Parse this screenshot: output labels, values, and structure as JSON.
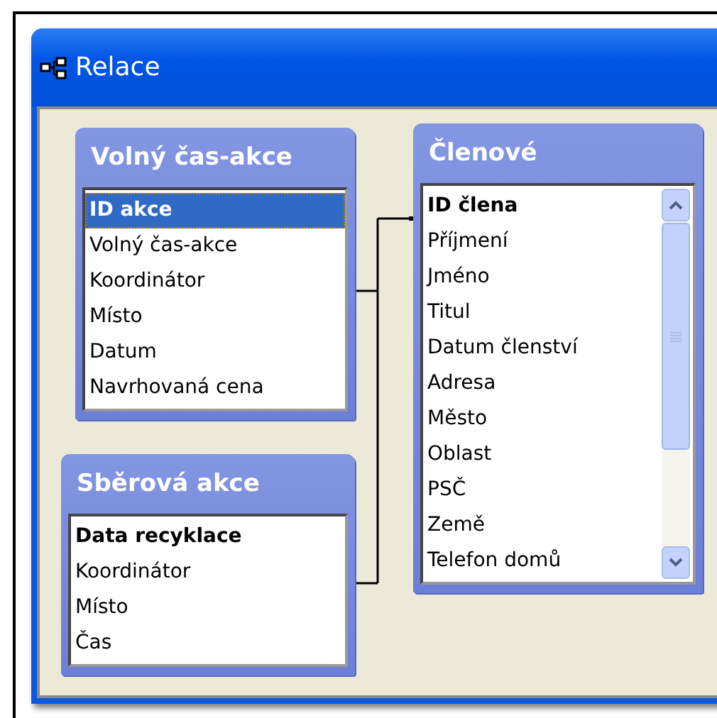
{
  "window": {
    "title": "Relace"
  },
  "tables": [
    {
      "title": "Volný čas-akce",
      "fields": [
        {
          "name": "ID akce",
          "key": true,
          "selected": true
        },
        {
          "name": "Volný čas-akce",
          "key": false,
          "selected": false
        },
        {
          "name": "Koordinátor",
          "key": false,
          "selected": false
        },
        {
          "name": "Místo",
          "key": false,
          "selected": false
        },
        {
          "name": "Datum",
          "key": false,
          "selected": false
        },
        {
          "name": "Navrhovaná cena",
          "key": false,
          "selected": false
        }
      ]
    },
    {
      "title": "Členové",
      "fields": [
        {
          "name": "ID člena",
          "key": true,
          "selected": false
        },
        {
          "name": "Příjmení",
          "key": false,
          "selected": false
        },
        {
          "name": "Jméno",
          "key": false,
          "selected": false
        },
        {
          "name": "Titul",
          "key": false,
          "selected": false
        },
        {
          "name": "Datum členství",
          "key": false,
          "selected": false
        },
        {
          "name": "Adresa",
          "key": false,
          "selected": false
        },
        {
          "name": "Město",
          "key": false,
          "selected": false
        },
        {
          "name": "Oblast",
          "key": false,
          "selected": false
        },
        {
          "name": "PSČ",
          "key": false,
          "selected": false
        },
        {
          "name": "Země",
          "key": false,
          "selected": false
        },
        {
          "name": "Telefon domů",
          "key": false,
          "selected": false
        }
      ]
    },
    {
      "title": "Sběrová akce",
      "fields": [
        {
          "name": "Data recyklace",
          "key": true,
          "selected": false
        },
        {
          "name": "Koordinátor",
          "key": false,
          "selected": false
        },
        {
          "name": "Místo",
          "key": false,
          "selected": false
        },
        {
          "name": "Čas",
          "key": false,
          "selected": false
        }
      ]
    }
  ]
}
